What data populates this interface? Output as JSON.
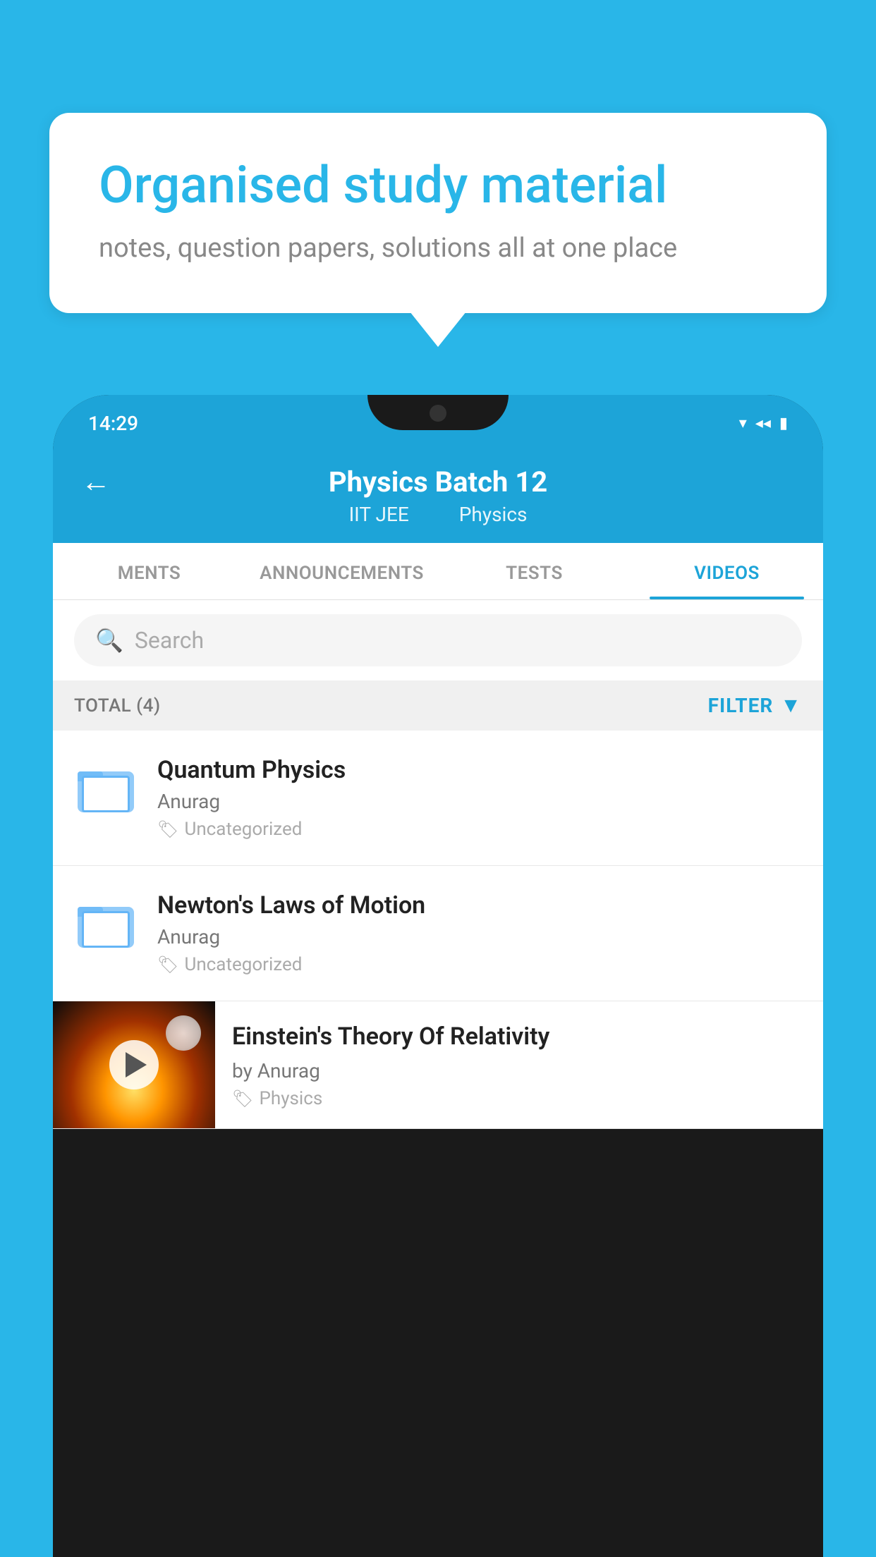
{
  "background": {
    "color": "#29b6e8"
  },
  "speech_bubble": {
    "title": "Organised study material",
    "subtitle": "notes, question papers, solutions all at one place"
  },
  "phone": {
    "status_bar": {
      "time": "14:29",
      "wifi_icon": "wifi",
      "signal_icon": "signal",
      "battery_icon": "battery"
    },
    "header": {
      "back_label": "←",
      "title": "Physics Batch 12",
      "subtitle_tag1": "IIT JEE",
      "subtitle_tag2": "Physics"
    },
    "tabs": [
      {
        "label": "MENTS",
        "active": false
      },
      {
        "label": "ANNOUNCEMENTS",
        "active": false
      },
      {
        "label": "TESTS",
        "active": false
      },
      {
        "label": "VIDEOS",
        "active": true
      }
    ],
    "search": {
      "placeholder": "Search"
    },
    "filter_row": {
      "total_label": "TOTAL (4)",
      "filter_label": "FILTER"
    },
    "videos": [
      {
        "id": 1,
        "title": "Quantum Physics",
        "author": "Anurag",
        "tag": "Uncategorized",
        "has_thumbnail": false
      },
      {
        "id": 2,
        "title": "Newton's Laws of Motion",
        "author": "Anurag",
        "tag": "Uncategorized",
        "has_thumbnail": false
      },
      {
        "id": 3,
        "title": "Einstein's Theory Of Relativity",
        "author": "by Anurag",
        "tag": "Physics",
        "has_thumbnail": true
      }
    ]
  }
}
